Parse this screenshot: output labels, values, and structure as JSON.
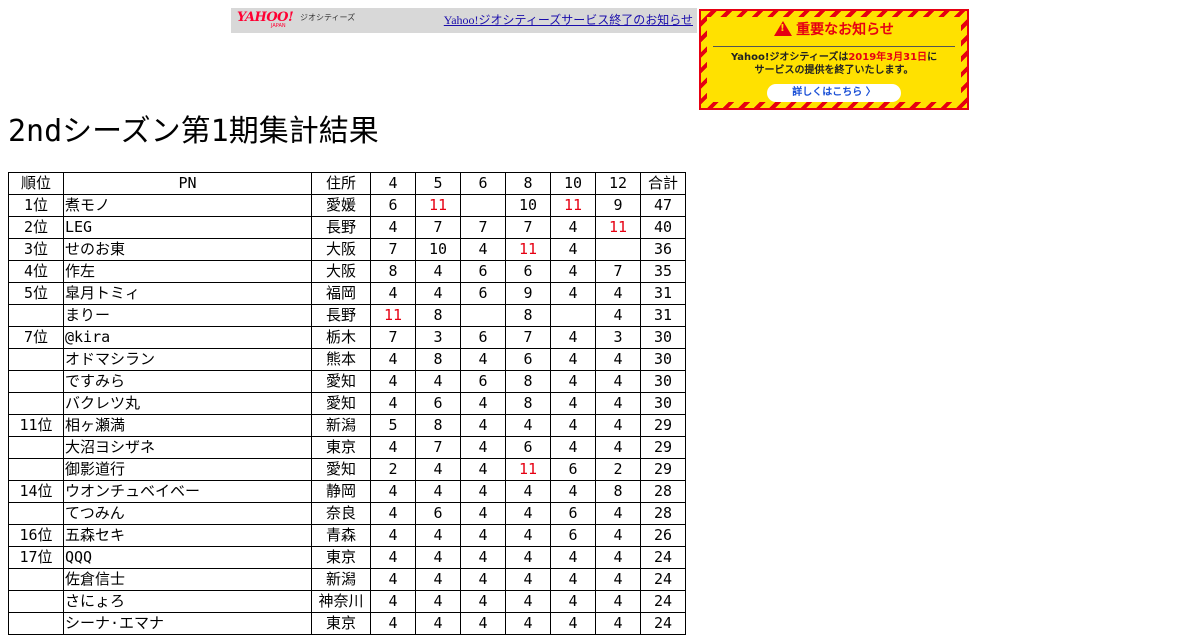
{
  "banner": {
    "logo_text": "YAHOO!",
    "logo_sub": "JAPAN",
    "brand_text": "ジオシティーズ",
    "link_text": "Yahoo!ジオシティーズサービス終了のお知らせ"
  },
  "notice": {
    "title": "重要なお知らせ",
    "line1_a": "Yahoo!ジオシティーズは",
    "line1_b": "2019年3月31日",
    "line1_c": "に",
    "line2": "サービスの提供を終了いたします。",
    "button": "詳しくはこちら 〉"
  },
  "page": {
    "title": "2ndシーズン第1期集計結果"
  },
  "table": {
    "headers": [
      "順位",
      "PN",
      "住所",
      "4",
      "5",
      "6",
      "8",
      "10",
      "12",
      "合計"
    ],
    "rows": [
      [
        "1位",
        "煮モノ",
        "愛媛",
        "6",
        "11",
        "",
        "10",
        "11",
        "9",
        "47"
      ],
      [
        "2位",
        "LEG",
        "長野",
        "4",
        "7",
        "7",
        "7",
        "4",
        "11",
        "40"
      ],
      [
        "3位",
        "せのお東",
        "大阪",
        "7",
        "10",
        "4",
        "11",
        "4",
        "",
        "36"
      ],
      [
        "4位",
        "作左",
        "大阪",
        "8",
        "4",
        "6",
        "6",
        "4",
        "7",
        "35"
      ],
      [
        "5位",
        "皐月トミィ",
        "福岡",
        "4",
        "4",
        "6",
        "9",
        "4",
        "4",
        "31"
      ],
      [
        "",
        "まりー",
        "長野",
        "11",
        "8",
        "",
        "8",
        "",
        "4",
        "31"
      ],
      [
        "7位",
        "@kira",
        "栃木",
        "7",
        "3",
        "6",
        "7",
        "4",
        "3",
        "30"
      ],
      [
        "",
        "オドマシラン",
        "熊本",
        "4",
        "8",
        "4",
        "6",
        "4",
        "4",
        "30"
      ],
      [
        "",
        "ですみら",
        "愛知",
        "4",
        "4",
        "6",
        "8",
        "4",
        "4",
        "30"
      ],
      [
        "",
        "バクレツ丸",
        "愛知",
        "4",
        "6",
        "4",
        "8",
        "4",
        "4",
        "30"
      ],
      [
        "11位",
        "相ヶ瀬満",
        "新潟",
        "5",
        "8",
        "4",
        "4",
        "4",
        "4",
        "29"
      ],
      [
        "",
        "大沼ヨシザネ",
        "東京",
        "4",
        "7",
        "4",
        "6",
        "4",
        "4",
        "29"
      ],
      [
        "",
        "御影道行",
        "愛知",
        "2",
        "4",
        "4",
        "11",
        "6",
        "2",
        "29"
      ],
      [
        "14位",
        "ウオンチュベイベー",
        "静岡",
        "4",
        "4",
        "4",
        "4",
        "4",
        "8",
        "28"
      ],
      [
        "",
        "てつみん",
        "奈良",
        "4",
        "6",
        "4",
        "4",
        "6",
        "4",
        "28"
      ],
      [
        "16位",
        "五森セキ",
        "青森",
        "4",
        "4",
        "4",
        "4",
        "6",
        "4",
        "26"
      ],
      [
        "17位",
        "QQQ",
        "東京",
        "4",
        "4",
        "4",
        "4",
        "4",
        "4",
        "24"
      ],
      [
        "",
        "佐倉信士",
        "新潟",
        "4",
        "4",
        "4",
        "4",
        "4",
        "4",
        "24"
      ],
      [
        "",
        "さにょろ",
        "神奈川",
        "4",
        "4",
        "4",
        "4",
        "4",
        "4",
        "24"
      ],
      [
        "",
        "シーナ·エマナ",
        "東京",
        "4",
        "4",
        "4",
        "4",
        "4",
        "4",
        "24"
      ]
    ],
    "highlight_value": "11",
    "highlight_color": "#e60012"
  }
}
